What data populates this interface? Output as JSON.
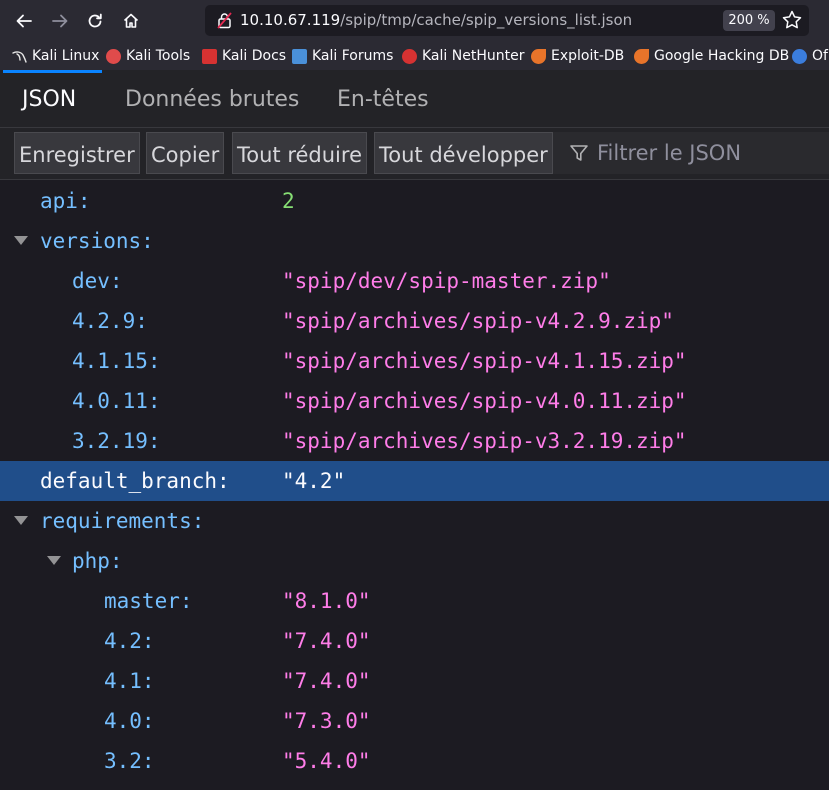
{
  "browser": {
    "url_host": "10.10.67.119",
    "url_path": "/spip/tmp/cache/spip_versions_list.json",
    "zoom": "200 %",
    "nav_icons": [
      "back-icon",
      "forward-icon",
      "reload-icon",
      "home-icon",
      "lock-icon",
      "bookmark-star-icon"
    ]
  },
  "bookmarks": [
    {
      "label": "Kali Linux",
      "icon": "kali-dragon-icon",
      "color": "#e6e6e6"
    },
    {
      "label": "Kali Tools",
      "icon": "kali-tools-icon",
      "color": "#e04b4b"
    },
    {
      "label": "Kali Docs",
      "icon": "kali-docs-icon",
      "color": "#d63232"
    },
    {
      "label": "Kali Forums",
      "icon": "kali-forums-icon",
      "color": "#4a90d9"
    },
    {
      "label": "Kali NetHunter",
      "icon": "nethunter-icon",
      "color": "#d63232"
    },
    {
      "label": "Exploit-DB",
      "icon": "exploit-db-icon",
      "color": "#e8742a"
    },
    {
      "label": "Google Hacking DB",
      "icon": "ghdb-icon",
      "color": "#e8742a"
    },
    {
      "label": "Of",
      "icon": "offsec-icon",
      "color": "#3b7ddd"
    }
  ],
  "viewer": {
    "tabs": [
      "JSON",
      "Données brutes",
      "En-têtes"
    ],
    "active_tab": "JSON",
    "toolbar": {
      "save": "Enregistrer",
      "copy": "Copier",
      "collapse_all": "Tout réduire",
      "expand_all": "Tout développer",
      "filter_placeholder": "Filtrer le JSON"
    }
  },
  "json_rows": [
    {
      "key": "api:",
      "value": "2",
      "type": "number",
      "depth": 0
    },
    {
      "key": "versions:",
      "value": "",
      "type": "object",
      "depth": 0
    },
    {
      "key": "dev:",
      "value": "\"spip/dev/spip-master.zip\"",
      "type": "string",
      "depth": 1
    },
    {
      "key": "4.2.9:",
      "value": "\"spip/archives/spip-v4.2.9.zip\"",
      "type": "string",
      "depth": 1
    },
    {
      "key": "4.1.15:",
      "value": "\"spip/archives/spip-v4.1.15.zip\"",
      "type": "string",
      "depth": 1
    },
    {
      "key": "4.0.11:",
      "value": "\"spip/archives/spip-v4.0.11.zip\"",
      "type": "string",
      "depth": 1
    },
    {
      "key": "3.2.19:",
      "value": "\"spip/archives/spip-v3.2.19.zip\"",
      "type": "string",
      "depth": 1
    },
    {
      "key": "default_branch:",
      "value": "\"4.2\"",
      "type": "string",
      "depth": 0,
      "selected": true
    },
    {
      "key": "requirements:",
      "value": "",
      "type": "object",
      "depth": 0
    },
    {
      "key": "php:",
      "value": "",
      "type": "object",
      "depth": 1
    },
    {
      "key": "master:",
      "value": "\"8.1.0\"",
      "type": "string",
      "depth": 2
    },
    {
      "key": "4.2:",
      "value": "\"7.4.0\"",
      "type": "string",
      "depth": 2
    },
    {
      "key": "4.1:",
      "value": "\"7.4.0\"",
      "type": "string",
      "depth": 2
    },
    {
      "key": "4.0:",
      "value": "\"7.3.0\"",
      "type": "string",
      "depth": 2
    },
    {
      "key": "3.2:",
      "value": "\"5.4.0\"",
      "type": "string",
      "depth": 2
    }
  ]
}
